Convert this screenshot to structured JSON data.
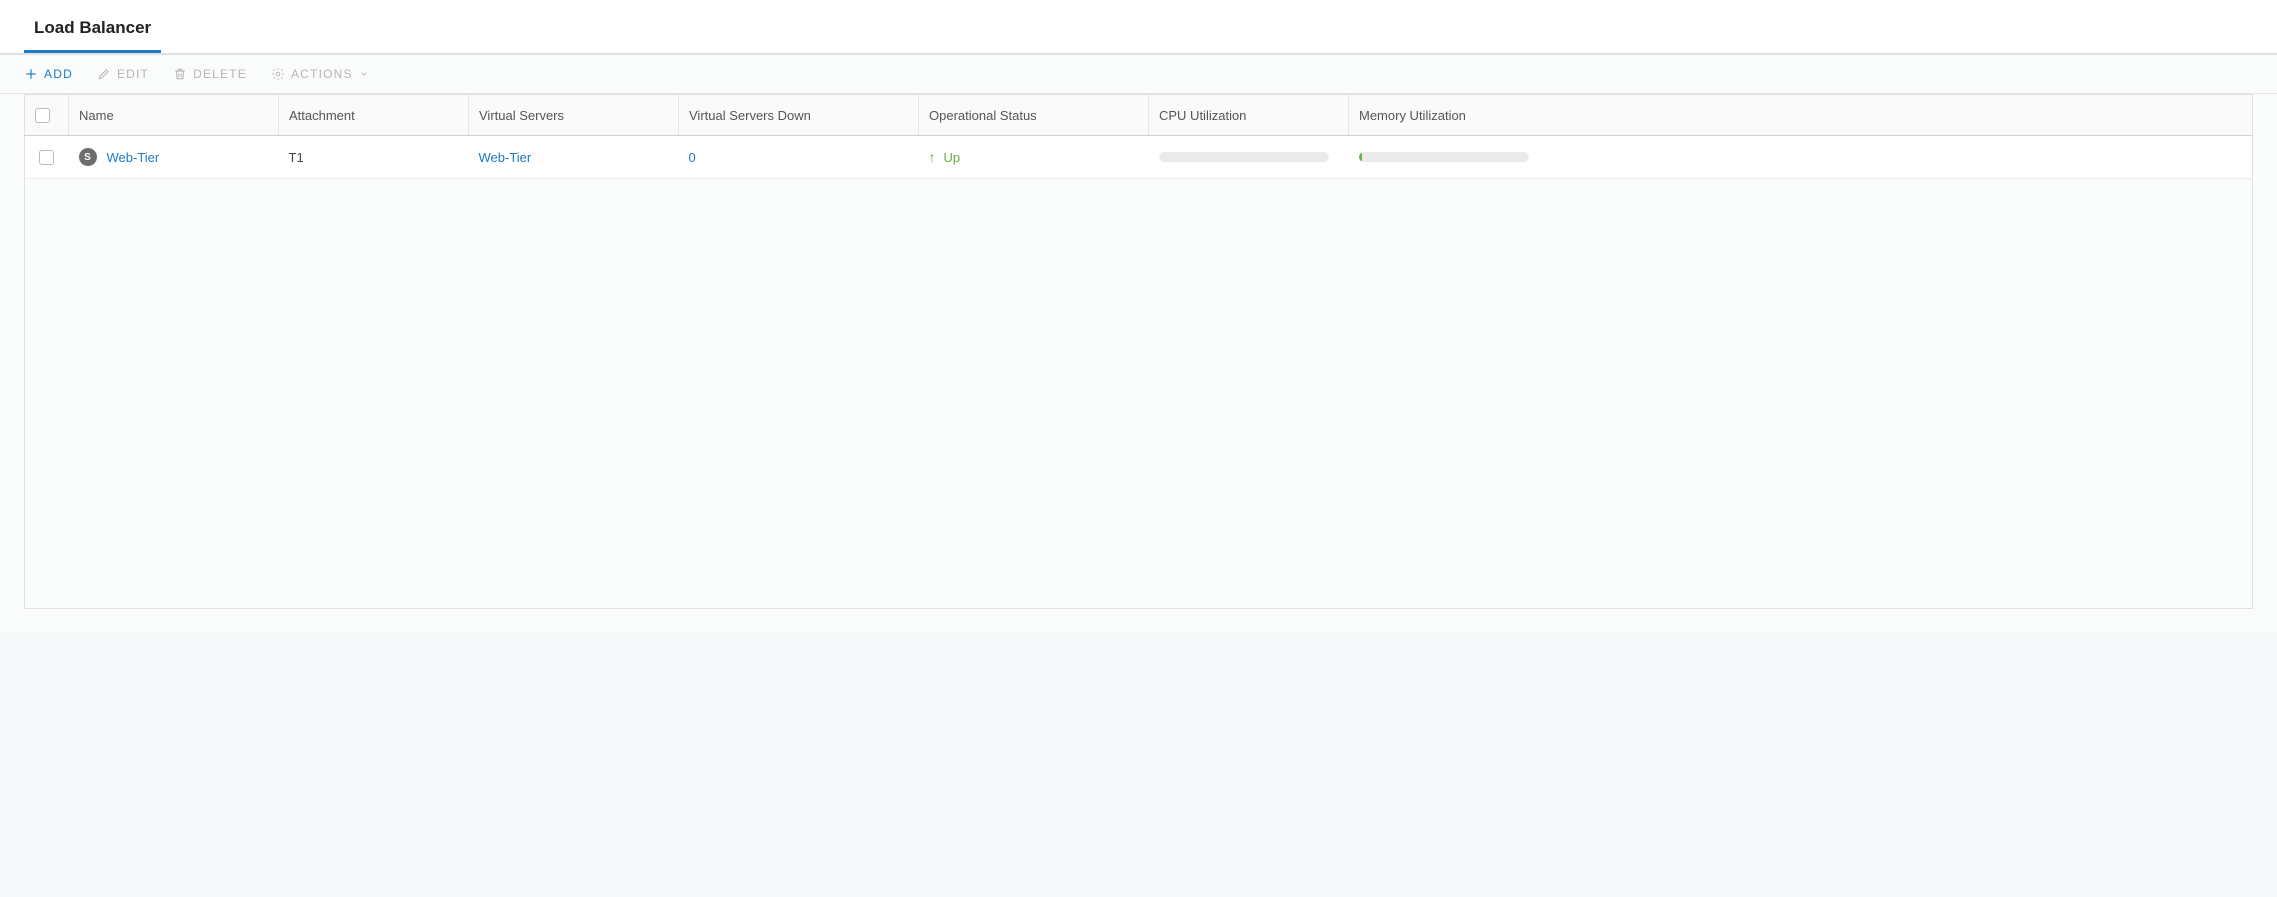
{
  "tabs": {
    "load_balancer": "Load Balancer"
  },
  "toolbar": {
    "add": "ADD",
    "edit": "EDIT",
    "delete": "DELETE",
    "actions": "ACTIONS"
  },
  "columns": {
    "name": "Name",
    "attachment": "Attachment",
    "virtual_servers": "Virtual Servers",
    "virtual_servers_down": "Virtual Servers Down",
    "operational_status": "Operational Status",
    "cpu_utilization": "CPU Utilization",
    "memory_utilization": "Memory Utilization"
  },
  "rows": [
    {
      "size_badge": "S",
      "name": "Web-Tier",
      "attachment": "T1",
      "virtual_servers": "Web-Tier",
      "virtual_servers_down": "0",
      "status": "Up",
      "cpu_pct": 0,
      "mem_pct": 2
    }
  ]
}
